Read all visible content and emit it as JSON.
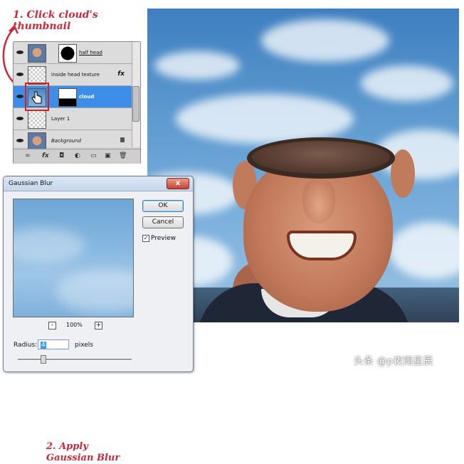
{
  "annotations": {
    "step1_line1": "1. Click cloud's",
    "step1_line2": "thumbnail",
    "step2_line1": "2. Apply",
    "step2_line2": "Gaussian Blur",
    "color": "#c9283b"
  },
  "layers_panel": {
    "layers": [
      {
        "name": "half head",
        "style": "underline",
        "thumbnail": "face",
        "mask": "black-blob"
      },
      {
        "name": "inside head texture",
        "style": "normal",
        "thumbnail": "transparent",
        "badge": "fx"
      },
      {
        "name": "cloud",
        "style": "bold",
        "thumbnail": "sky",
        "mask": "gradient",
        "selected": true
      },
      {
        "name": "Layer 1",
        "style": "normal",
        "thumbnail": "transparent"
      },
      {
        "name": "Background",
        "style": "italic",
        "thumbnail": "face",
        "locked": true
      }
    ],
    "fx_label": "fx",
    "footer_icons": [
      "link-icon",
      "fx-icon",
      "mask-icon",
      "adjustment-icon",
      "folder-icon",
      "new-layer-icon",
      "trash-icon"
    ],
    "footer_glyphs": [
      "∞",
      "fx",
      "◘",
      "◐",
      "▭",
      "▣",
      "🗑"
    ]
  },
  "gaussian_blur_dialog": {
    "title": "Gaussian Blur",
    "close": "x",
    "ok_label": "OK",
    "cancel_label": "Cancel",
    "preview_label": "Preview",
    "preview_checked": true,
    "zoom_minus": "-",
    "zoom_plus": "+",
    "zoom_level": "100%",
    "radius_label": "Radius:",
    "radius_value": "4",
    "radius_unit": "pixels"
  },
  "watermark": "头条 @p夜雨星辰",
  "colors": {
    "selection": "#3d8ee8",
    "highlight_box": "#d62020",
    "sky": "#5e9ad0"
  }
}
